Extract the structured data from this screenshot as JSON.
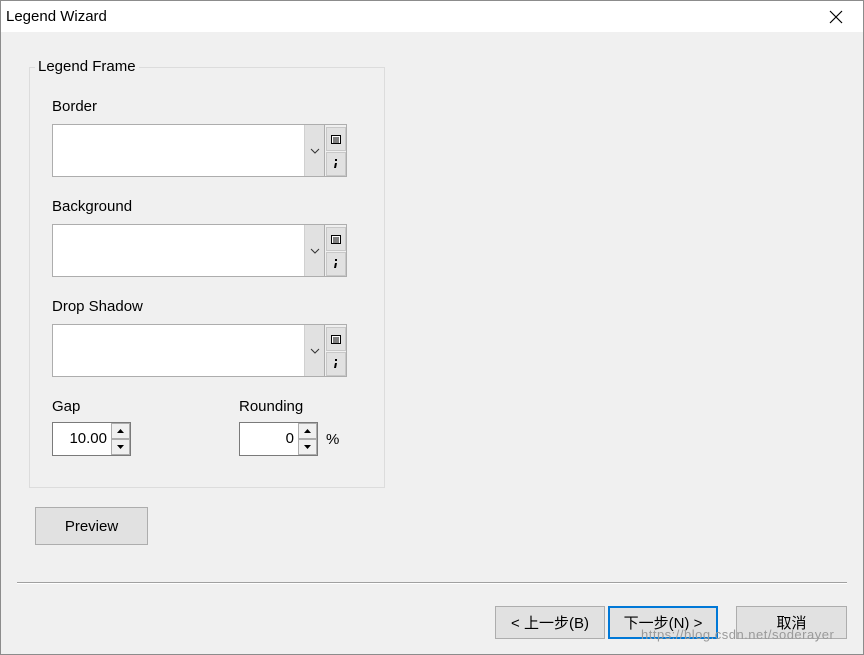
{
  "window": {
    "title": "Legend Wizard"
  },
  "groupbox": {
    "title": "Legend Frame"
  },
  "border": {
    "label": "Border",
    "value": ""
  },
  "background": {
    "label": "Background",
    "value": ""
  },
  "drop_shadow": {
    "label": "Drop Shadow",
    "value": ""
  },
  "gap": {
    "label": "Gap",
    "value": "10.00"
  },
  "rounding": {
    "label": "Rounding",
    "value": "0",
    "unit": "%"
  },
  "preview_button": {
    "label": "Preview"
  },
  "footer": {
    "back_label": "< 上一步(B)",
    "next_label": "下一步(N) >",
    "cancel_label": "取消"
  },
  "watermark": "https://blog.csdn.net/soderayer",
  "icons": {
    "close": "close-icon",
    "dropdown": "chevron-down-icon",
    "properties": "properties-icon",
    "info": "info-icon",
    "spin_up": "arrow-up-icon",
    "spin_down": "arrow-down-icon"
  },
  "colors": {
    "accent": "#0078d7",
    "window_bg": "#f0f0f0",
    "titlebar_bg": "#ffffff"
  }
}
